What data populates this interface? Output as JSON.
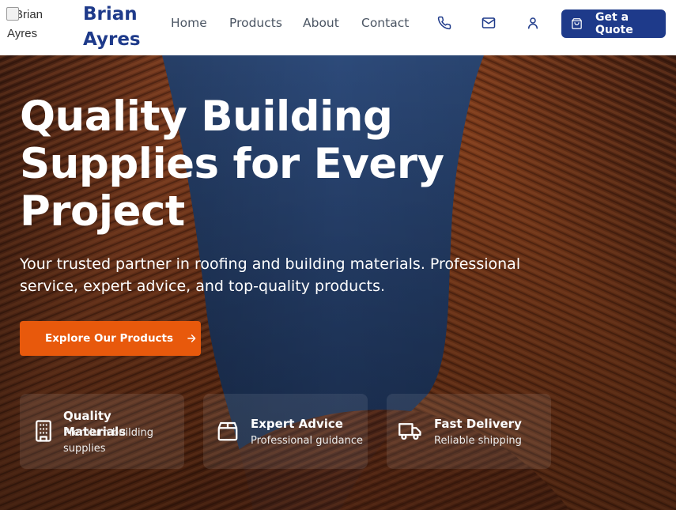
{
  "header": {
    "logo_alt_line1": "Brian",
    "logo_alt_line2": "Ayres",
    "brand_line1": "Brian",
    "brand_line2": "Ayres",
    "nav": [
      "Home",
      "Products",
      "About",
      "Contact"
    ],
    "icons": [
      "phone-icon",
      "mail-icon",
      "user-icon"
    ],
    "quote_button": "Get a Quote",
    "quote_icon": "shopping-bag-icon"
  },
  "hero": {
    "title": "Quality Building Supplies for Every Project",
    "subtitle": "Your trusted partner in roofing and building materials. Professional service, expert advice, and top-quality products.",
    "cta_label": "Explore Our Products",
    "cta_icon": "arrow-right-icon",
    "features": [
      {
        "icon": "building-icon",
        "title": "Quality Materials",
        "desc": "Premium building supplies"
      },
      {
        "icon": "package-icon",
        "title": "Expert Advice",
        "desc": "Professional guidance"
      },
      {
        "icon": "truck-icon",
        "title": "Fast Delivery",
        "desc": "Reliable shipping"
      }
    ]
  },
  "colors": {
    "brand_blue": "#1e3a8a",
    "cta_orange": "#e8590c",
    "nav_text": "#4b5563",
    "sky_blue": "#2e4a78",
    "facade_brown": "#8a3f1f"
  }
}
